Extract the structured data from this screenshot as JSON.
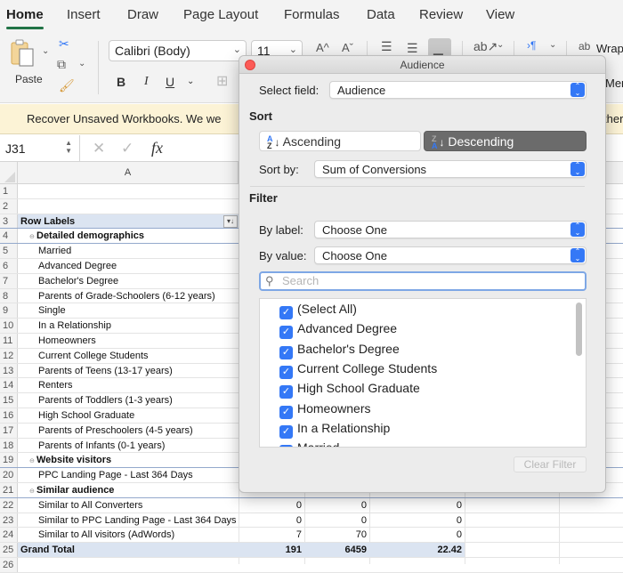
{
  "ribbon_tabs": [
    "Home",
    "Insert",
    "Draw",
    "Page Layout",
    "Formulas",
    "Data",
    "Review",
    "View"
  ],
  "active_tab": "Home",
  "ribbon": {
    "paste_label": "Paste",
    "font_name": "Calibri (Body)",
    "font_size": "11",
    "bold": "B",
    "italic": "I",
    "underline": "U",
    "grow_font": "A^",
    "shrink_font": "Aˇ",
    "wrap_label": "Wrap",
    "merge_label": "Merg"
  },
  "notification": {
    "text": "Recover Unsaved Workbooks.  We we",
    "tail": "ther"
  },
  "formula_bar": {
    "name_box": "J31",
    "fx_label": "fx",
    "formula": ""
  },
  "grid": {
    "column_headers": [
      "A"
    ],
    "rows": [
      {
        "num": "1",
        "label": "",
        "level": 2,
        "values": [
          "",
          "",
          ""
        ]
      },
      {
        "num": "2",
        "label": "",
        "level": 2,
        "values": [
          "",
          "",
          ""
        ]
      },
      {
        "num": "3",
        "label": "Row Labels",
        "level": 0,
        "type": "hdr",
        "values": [
          "",
          "",
          ""
        ]
      },
      {
        "num": "4",
        "label": "Detailed demographics",
        "level": 1,
        "type": "sect",
        "values": [
          "",
          "",
          ""
        ]
      },
      {
        "num": "5",
        "label": "Married",
        "level": 2,
        "values": [
          "",
          "",
          ""
        ]
      },
      {
        "num": "6",
        "label": "Advanced Degree",
        "level": 2,
        "values": [
          "",
          "",
          ""
        ]
      },
      {
        "num": "7",
        "label": "Bachelor's Degree",
        "level": 2,
        "values": [
          "",
          "",
          ""
        ]
      },
      {
        "num": "8",
        "label": "Parents of Grade-Schoolers (6-12 years)",
        "level": 2,
        "values": [
          "",
          "",
          ""
        ]
      },
      {
        "num": "9",
        "label": "Single",
        "level": 2,
        "values": [
          "",
          "",
          ""
        ]
      },
      {
        "num": "10",
        "label": "In a Relationship",
        "level": 2,
        "values": [
          "",
          "",
          ""
        ]
      },
      {
        "num": "11",
        "label": "Homeowners",
        "level": 2,
        "values": [
          "",
          "",
          ""
        ]
      },
      {
        "num": "12",
        "label": "Current College Students",
        "level": 2,
        "values": [
          "",
          "",
          ""
        ]
      },
      {
        "num": "13",
        "label": "Parents of Teens (13-17 years)",
        "level": 2,
        "values": [
          "",
          "",
          ""
        ]
      },
      {
        "num": "14",
        "label": "Renters",
        "level": 2,
        "values": [
          "",
          "",
          ""
        ]
      },
      {
        "num": "15",
        "label": "Parents of Toddlers (1-3 years)",
        "level": 2,
        "values": [
          "",
          "",
          ""
        ]
      },
      {
        "num": "16",
        "label": "High School Graduate",
        "level": 2,
        "values": [
          "",
          "",
          ""
        ]
      },
      {
        "num": "17",
        "label": "Parents of Preschoolers (4-5 years)",
        "level": 2,
        "values": [
          "",
          "",
          ""
        ]
      },
      {
        "num": "18",
        "label": "Parents of Infants (0-1 years)",
        "level": 2,
        "values": [
          "",
          "",
          ""
        ]
      },
      {
        "num": "19",
        "label": "Website visitors",
        "level": 1,
        "type": "sect",
        "values": [
          "",
          "",
          ""
        ]
      },
      {
        "num": "20",
        "label": "PPC Landing Page - Last 364 Days",
        "level": 2,
        "values": [
          "",
          "",
          ""
        ]
      },
      {
        "num": "21",
        "label": "Similar audience",
        "level": 1,
        "type": "sect",
        "values": [
          "",
          "",
          ""
        ]
      },
      {
        "num": "22",
        "label": "Similar to All Converters",
        "level": 2,
        "values": [
          "0",
          "0",
          "0"
        ]
      },
      {
        "num": "23",
        "label": "Similar to PPC Landing Page - Last 364 Days",
        "level": 2,
        "values": [
          "0",
          "0",
          "0"
        ]
      },
      {
        "num": "24",
        "label": "Similar to All visitors (AdWords)",
        "level": 2,
        "values": [
          "7",
          "70",
          "0"
        ]
      },
      {
        "num": "25",
        "label": "Grand Total",
        "level": 0,
        "type": "total",
        "values": [
          "191",
          "6459",
          "22.42"
        ]
      },
      {
        "num": "26",
        "label": "",
        "level": 2,
        "values": [
          "",
          "",
          ""
        ]
      }
    ]
  },
  "dialog": {
    "title": "Audience",
    "select_field_label": "Select field:",
    "select_field_value": "Audience",
    "sort_heading": "Sort",
    "ascending_label": "Ascending",
    "descending_label": "Descending",
    "sort_selected": "Descending",
    "sort_by_label": "Sort by:",
    "sort_by_value": "Sum of Conversions",
    "filter_heading": "Filter",
    "by_label_label": "By label:",
    "by_label_value": "Choose One",
    "by_value_label": "By value:",
    "by_value_value": "Choose One",
    "search_placeholder": "Search",
    "filter_items": [
      {
        "label": "(Select All)",
        "checked": true
      },
      {
        "label": "Advanced Degree",
        "checked": true
      },
      {
        "label": "Bachelor's Degree",
        "checked": true
      },
      {
        "label": "Current College Students",
        "checked": true
      },
      {
        "label": "High School Graduate",
        "checked": true
      },
      {
        "label": "Homeowners",
        "checked": true
      },
      {
        "label": "In a Relationship",
        "checked": true
      },
      {
        "label": "Married",
        "checked": true
      }
    ],
    "clear_filter_label": "Clear Filter"
  },
  "colors": {
    "accent_green": "#217346",
    "checkbox_blue": "#3478f6",
    "pivot_header_bg": "#dbe4f1",
    "notice_bg": "#fcf3d6",
    "close_red": "#fc5b57"
  }
}
